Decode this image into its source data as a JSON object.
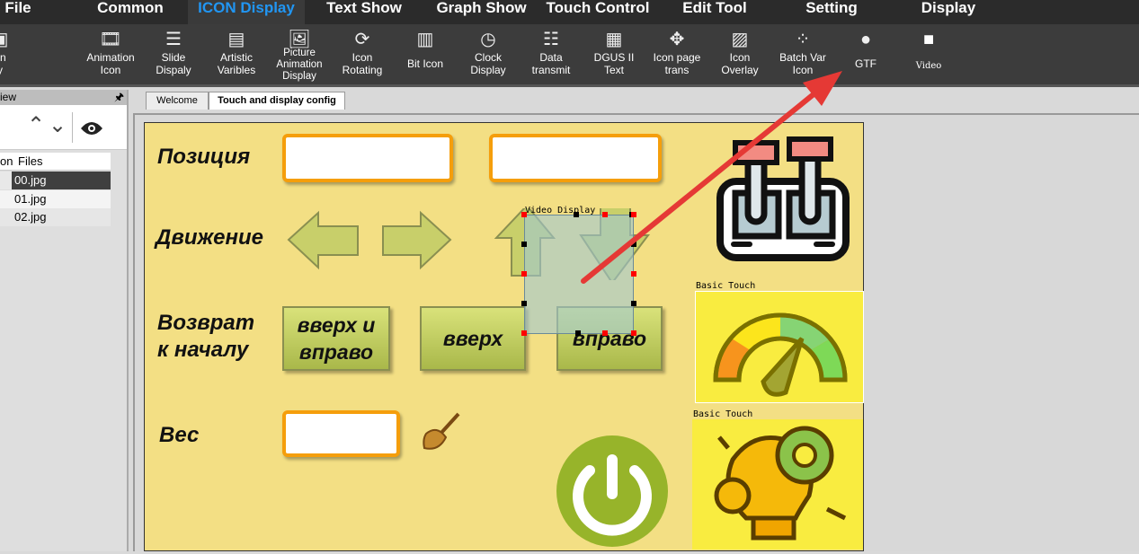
{
  "menu": [
    "File",
    "Common",
    "ICON Display",
    "Text Show",
    "Graph Show",
    "Touch Control",
    "Edit Tool",
    "Setting",
    "Display"
  ],
  "toolbar": [
    {
      "label": "on\ny",
      "icon": "icon-display-icon"
    },
    {
      "label": "Animation\nIcon",
      "icon": "film-icon"
    },
    {
      "label": "Slide\nDispaly",
      "icon": "sliders-icon"
    },
    {
      "label": "Artistic\nVaribles",
      "icon": "artistic-text-icon"
    },
    {
      "label": "Picture\nAnimation\nDisplay",
      "icon": "picture-icon"
    },
    {
      "label": "Icon\nRotating",
      "icon": "rotate-icon"
    },
    {
      "label": "Bit Icon",
      "icon": "binary-icon"
    },
    {
      "label": "Clock\nDisplay",
      "icon": "clock-icon"
    },
    {
      "label": "Data\ntransmit",
      "icon": "data-transmit-icon"
    },
    {
      "label": "DGUS II\nText",
      "icon": "txt-file-icon"
    },
    {
      "label": "Icon page\ntrans",
      "icon": "move-icon"
    },
    {
      "label": "Icon\nOverlay",
      "icon": "overlay-icon"
    },
    {
      "label": "Batch Var\nIcon",
      "icon": "batch-icon"
    },
    {
      "label": "GTF",
      "icon": "gtf-icon"
    },
    {
      "label": "Video",
      "icon": "video-camera-icon"
    }
  ],
  "left_panel": {
    "title": "iew",
    "columns": [
      "on",
      "Files"
    ],
    "files": [
      "00.jpg",
      "01.jpg",
      "02.jpg"
    ]
  },
  "tabs": [
    "Welcome",
    "Touch and display config"
  ],
  "design": {
    "labels": {
      "position": "Позиция",
      "movement": "Движение",
      "return1": "Возврат",
      "return2": "к началу",
      "weight": "Вес"
    },
    "buttons": {
      "up_right_1": "вверх и",
      "up_right_2": "вправо",
      "up": "вверх",
      "right": "вправо"
    },
    "captions": {
      "video": "Video Display",
      "touch1": "Basic Touch",
      "touch2": "Basic Touch"
    }
  },
  "colors": {
    "accent": "#2196f3",
    "canvas": "#f3df84",
    "arrow": "#e53935"
  }
}
